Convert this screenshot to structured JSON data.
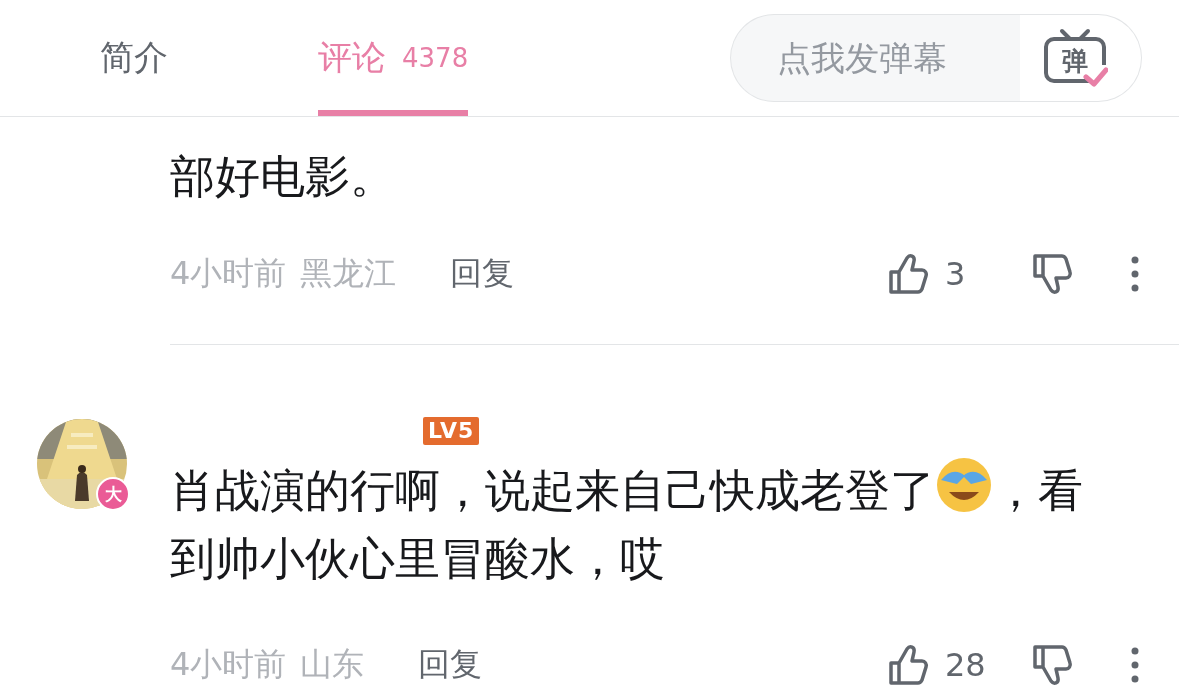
{
  "tabs": [
    {
      "label": "简介",
      "selected": false
    },
    {
      "label": "评论",
      "count": "4378",
      "selected": true
    }
  ],
  "danmaku": {
    "placeholder": "点我发弹幕",
    "button_label": "弹"
  },
  "comments": [
    {
      "content": [
        {
          "kind": "text",
          "text": "部好电影。"
        }
      ],
      "time": "4小时前",
      "location": "黑龙江",
      "reply": "回复",
      "likes": "3"
    },
    {
      "avatar": {
        "kind": "picture",
        "badge": "大"
      },
      "level_badge": "LV5",
      "content": [
        {
          "kind": "text",
          "text": "肖战演的行啊，说起来自己快成老登了"
        },
        {
          "kind": "emoji"
        },
        {
          "kind": "text",
          "text": "，看"
        },
        {
          "kind": "text",
          "text": "到帅小伙心里冒酸水，哎"
        }
      ],
      "time": "4小时前",
      "location": "山东",
      "reply": "回复",
      "likes": "28"
    }
  ]
}
